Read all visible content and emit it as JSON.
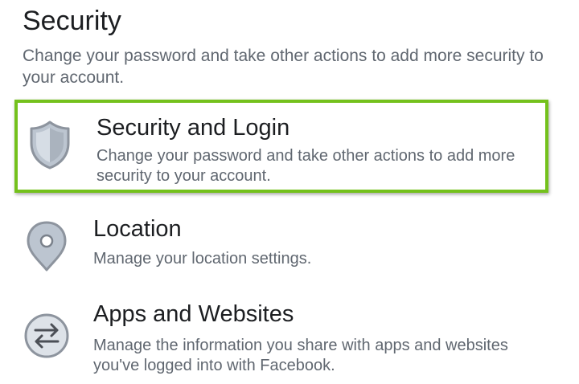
{
  "section": {
    "title": "Security",
    "description": "Change your password and take other actions to add more security to your account."
  },
  "items": [
    {
      "icon": "shield-icon",
      "title": "Security and Login",
      "description": "Change your password and take other actions to add more security to your account.",
      "highlighted": true
    },
    {
      "icon": "location-pin-icon",
      "title": "Location",
      "description": "Manage your location settings."
    },
    {
      "icon": "swap-arrows-icon",
      "title": "Apps and Websites",
      "description": "Manage the information you share with apps and websites you've logged into with Facebook."
    }
  ],
  "colors": {
    "highlight_border": "#74c11c",
    "icon_fill": "#bcc5d0",
    "icon_stroke": "#8d949e",
    "title_text": "#1c1e21",
    "secondary_text": "#606770"
  }
}
